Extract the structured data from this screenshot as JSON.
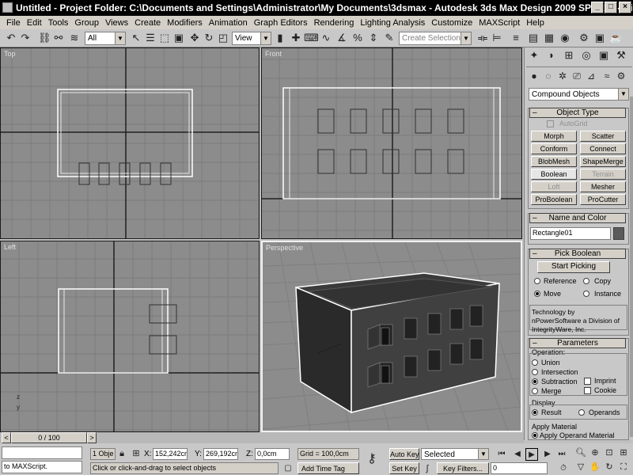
{
  "window": {
    "title": "Untitled    - Project Folder: C:\\Documents and Settings\\Administrator\\My Documents\\3dsmax    - Autodesk 3ds Max Design 2009 SP1  x64    - Di...",
    "min_glyph": "_",
    "max_glyph": "□",
    "close_glyph": "×"
  },
  "menu": [
    "File",
    "Edit",
    "Tools",
    "Group",
    "Views",
    "Create",
    "Modifiers",
    "Animation",
    "Graph Editors",
    "Rendering",
    "Lighting Analysis",
    "Customize",
    "MAXScript",
    "Help"
  ],
  "toolbar": {
    "selection_filter": "All",
    "ref_coord": "View",
    "named_selection_placeholder": "Create Selection Set"
  },
  "viewports": {
    "top": "Top",
    "front": "Front",
    "left": "Left",
    "perspective": "Perspective",
    "axis_z": "z",
    "axis_x": "x",
    "axis_y": "y"
  },
  "command_panel": {
    "category": "Compound Objects",
    "object_type": {
      "title": "Object Type",
      "autogrid": "AutoGrid",
      "buttons": [
        "Morph",
        "Scatter",
        "Conform",
        "Connect",
        "BlobMesh",
        "ShapeMerge",
        "Boolean",
        "Terrain",
        "Loft",
        "Mesher",
        "ProBoolean",
        "ProCutter"
      ]
    },
    "name_color": {
      "title": "Name and Color",
      "name": "Rectangle01",
      "color": "#5a5a5a"
    },
    "pick_boolean": {
      "title": "Pick Boolean",
      "start_picking": "Start Picking",
      "reference": "Reference",
      "copy": "Copy",
      "move": "Move",
      "instance": "Instance",
      "credit": "Technology by nPowerSoftware a Division of IntegrityWare, Inc."
    },
    "parameters": {
      "title": "Parameters",
      "operation_label": "Operation:",
      "union": "Union",
      "intersection": "Intersection",
      "subtraction": "Subtraction",
      "imprint": "Imprint",
      "merge": "Merge",
      "cookie": "Cookie",
      "display_label": "Display",
      "result": "Result",
      "operands": "Operands",
      "apply_material_label": "Apply Material",
      "apply_operand_material": "Apply Operand Material"
    }
  },
  "status": {
    "time_slider": "0 / 100",
    "maxscript": "to MAXScript.",
    "selection_count": "1 Obje",
    "x_label": "X:",
    "x_value": "152,242cm",
    "y_label": "Y:",
    "y_value": "269,192cm",
    "z_label": "Z:",
    "z_value": "0,0cm",
    "grid": "Grid = 100,0cm",
    "prompt": "Click or click-and-drag to select objects",
    "auto_key": "Auto Key",
    "set_key": "Set Key",
    "key_mode": "Selected",
    "key_filters": "Key Filters...",
    "add_time_tag": "Add Time Tag",
    "frame": "0"
  }
}
